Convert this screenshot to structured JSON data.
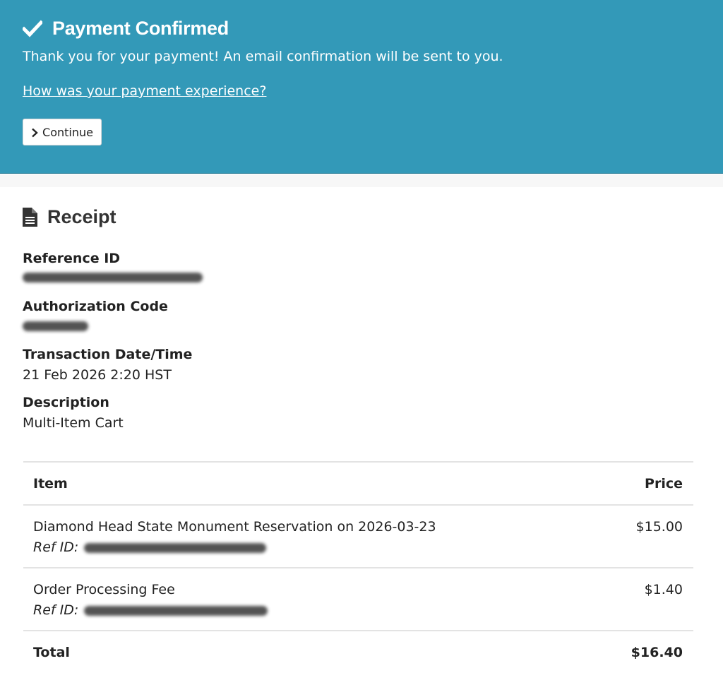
{
  "banner": {
    "title": "Payment Confirmed",
    "message": "Thank you for your payment! An email confirmation will be sent to you.",
    "survey_link": "How was your payment experience?",
    "continue_label": "Continue",
    "background_color": "#3399b8"
  },
  "receipt": {
    "title": "Receipt",
    "icon": "document-icon",
    "fields": {
      "reference_id_label": "Reference ID",
      "authorization_code_label": "Authorization Code",
      "transaction_datetime_label": "Transaction Date/Time",
      "transaction_datetime_value": "21 Feb 2026 2:20 HST",
      "description_label": "Description",
      "description_value": "Multi-Item Cart"
    },
    "table": {
      "header_item": "Item",
      "header_price": "Price",
      "ref_label": "Ref ID:",
      "items": [
        {
          "name": "Diamond Head State Monument Reservation on 2026-03-23",
          "price": "$15.00"
        },
        {
          "name": "Order Processing Fee",
          "price": "$1.40"
        }
      ],
      "total_label": "Total",
      "total_value": "$16.40"
    }
  }
}
